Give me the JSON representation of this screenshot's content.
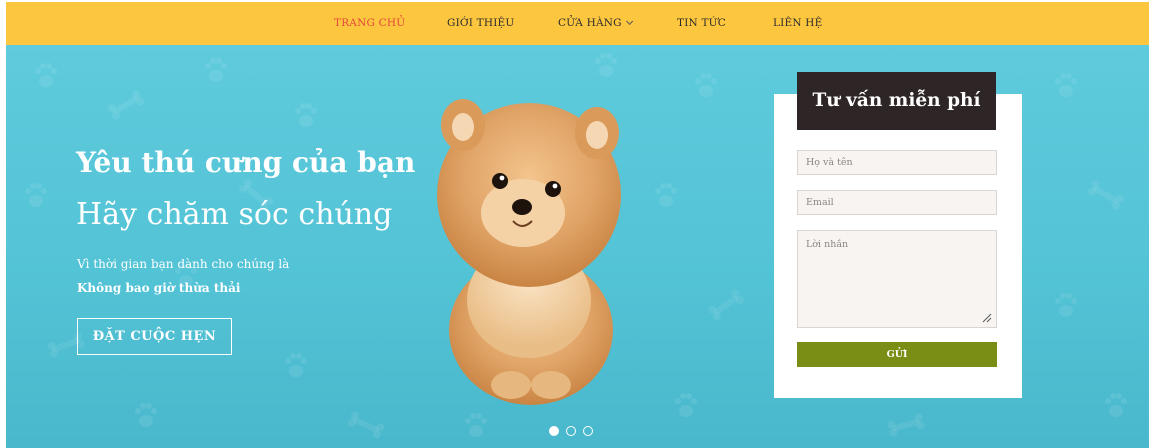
{
  "nav": {
    "items": [
      {
        "label": "TRANG CHỦ",
        "active": true
      },
      {
        "label": "GIỚI THIỆU",
        "active": false
      },
      {
        "label": "CỬA HÀNG",
        "active": false,
        "has_dropdown": true
      },
      {
        "label": "TIN TỨC",
        "active": false
      },
      {
        "label": "LIÊN HỆ",
        "active": false
      }
    ],
    "dropdown_icon": "chevron-down-icon"
  },
  "hero": {
    "headline": "Yêu thú cưng của bạn",
    "subline": "Hãy chăm sóc chúng",
    "description_line1": "Vì thời gian bạn dành cho chúng là",
    "description_line2": "Không bao giờ thừa thải",
    "cta_label": "ĐẶT CUỘC HẸN",
    "image": "pomeranian-puppy",
    "slides": {
      "count": 3,
      "active_index": 0
    }
  },
  "form": {
    "title": "Tư vấn miễn phí",
    "name_placeholder": "Họ và tên",
    "email_placeholder": "Email",
    "message_placeholder": "Lời nhắn",
    "submit_label": "GỬI"
  },
  "colors": {
    "nav_background": "#fdc63f",
    "nav_active": "#e3473e",
    "hero_background": "#56c5d8",
    "form_header": "#2e2626",
    "submit_button": "#7a8e16"
  }
}
